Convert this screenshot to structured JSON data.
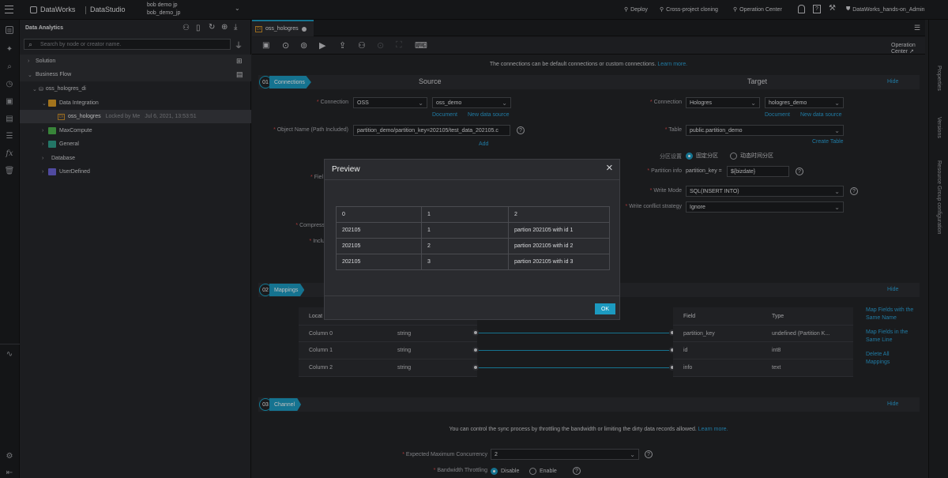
{
  "topbar": {
    "brand": "DataWorks",
    "product": "DataStudio",
    "workspace_line1": "bob demo jp",
    "workspace_line2": "bob_demo_jp",
    "deploy": "Deploy",
    "cross": "Cross-project cloning",
    "ops": "Operation Center",
    "user": "DataWorks_hands-on_Admin"
  },
  "sidebar": {
    "title": "Data Analytics",
    "search_placeholder": "Search by node or creator name.",
    "solution": "Solution",
    "business_flow": "Business Flow",
    "flow_name": "oss_hologres_di",
    "data_integration": "Data Integration",
    "node_name": "oss_hologres",
    "node_lock": "Locked by Me",
    "node_time": "Jul 6, 2021, 13:53:51",
    "maxcompute": "MaxCompute",
    "general": "General",
    "database": "Database",
    "userdefined": "UserDefined",
    "di_tag": "DI"
  },
  "editor": {
    "tab_label": "oss_hologres",
    "tab_tag": "DI",
    "operation_center": "Operation Center",
    "info_text": "The connections can be default connections or custom connections.",
    "info_link": "Learn more."
  },
  "connections": {
    "num": "01",
    "title": "Connections",
    "source": "Source",
    "target": "Target",
    "hide": "Hide",
    "src_connection_label": "Connection",
    "src_type": "OSS",
    "src_name": "oss_demo",
    "doc": "Document",
    "new_ds": "New data source",
    "object_label": "Object Name (Path Included)",
    "object_value": "partition_demo/partition_key=202105/test_data_202105.c",
    "add": "Add",
    "fields_label": "Fiel",
    "compress_label": "Compress",
    "include_label": "Inclu",
    "tgt_connection_label": "Connection",
    "tgt_type": "Hologres",
    "tgt_name": "hologres_demo",
    "table_label": "Table",
    "table_value": "public.partition_demo",
    "create_table": "Create Table",
    "partition_setting_label": "分区设置",
    "partition_opt1": "固定分区",
    "partition_opt2": "动态时间分区",
    "partition_info_label": "Partition info",
    "partition_key_text": "partition_key =",
    "partition_value": "${bizdate}",
    "write_mode_label": "Write Mode",
    "write_mode_value": "SQL(INSERT INTO)",
    "conflict_label": "Write conflict strategy",
    "conflict_value": "Ignore"
  },
  "mappings": {
    "num": "02",
    "title": "Mappings",
    "hide": "Hide",
    "left_header": "Locat",
    "right_header_field": "Field",
    "right_header_type": "Type",
    "rows": [
      {
        "src": "Column 0",
        "stype": "string",
        "field": "partition_key",
        "ftype": "undefined  (Partition K..."
      },
      {
        "src": "Column 1",
        "stype": "string",
        "field": "id",
        "ftype": "int8"
      },
      {
        "src": "Column 2",
        "stype": "string",
        "field": "info",
        "ftype": "text"
      }
    ],
    "same_name": "Map Fields with the Same Name",
    "same_line": "Map Fields in the Same Line",
    "delete_all": "Delete All Mappings"
  },
  "channel": {
    "num": "03",
    "title": "Channel",
    "hide": "Hide",
    "info": "You can control the sync process by throttling the bandwidth or limiting the dirty data records allowed.",
    "info_link": "Learn more.",
    "concurrency_label": "Expected Maximum Concurrency",
    "concurrency_value": "2",
    "bandwidth_label": "Bandwidth Throttling",
    "disable": "Disable",
    "enable": "Enable"
  },
  "right_tabs": {
    "properties": "Properties",
    "versions": "Versions",
    "resource": "Resource Group configuration"
  },
  "preview": {
    "title": "Preview",
    "ok": "OK",
    "headers": [
      "0",
      "1",
      "2"
    ],
    "rows": [
      [
        "202105",
        "1",
        "partion 202105 with id 1"
      ],
      [
        "202105",
        "2",
        "partion 202105 with id 2"
      ],
      [
        "202105",
        "3",
        "partion 202105 with id 3"
      ]
    ]
  },
  "colors": {
    "accent": "#1c9ac0",
    "link": "#2ba3d9"
  }
}
